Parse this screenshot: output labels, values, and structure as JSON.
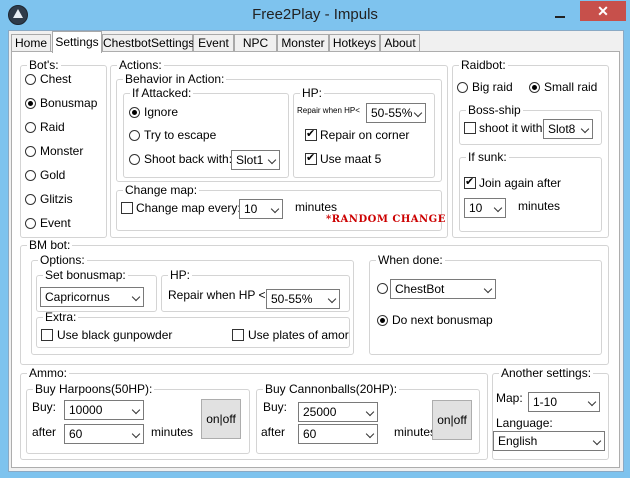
{
  "window": {
    "title": "Free2Play - Impuls",
    "close_glyph": "✕"
  },
  "tabs": [
    "Home",
    "Settings",
    "ChestbotSettings",
    "Event",
    "NPC",
    "Monster",
    "Hotkeys",
    "About"
  ],
  "bots": {
    "title": "Bot's:",
    "options": [
      "Chest",
      "Bonusmap",
      "Raid",
      "Monster",
      "Gold",
      "Glitzis",
      "Event"
    ],
    "selected": "Bonusmap"
  },
  "actions": {
    "title": "Actions:",
    "behavior": {
      "title": "Behavior in Action:",
      "if_attacked": {
        "title": "If Attacked:",
        "ignore": "Ignore",
        "escape": "Try to escape",
        "shoot_back": "Shoot back with:",
        "slot_value": "Slot1"
      },
      "hp": {
        "title": "HP:",
        "repair_label": "Repair when HP<",
        "repair_value": "50-55%",
        "repair_corner": "Repair on corner",
        "use_maat": "Use maat 5"
      }
    },
    "change_map": {
      "title": "Change map:",
      "label": "Change map every:",
      "value": "10",
      "minutes": "minutes",
      "random": "*RANDOM CHANGE"
    }
  },
  "raidbot": {
    "title": "Raidbot:",
    "big": "Big raid",
    "small": "Small raid",
    "boss_ship": {
      "title": "Boss-ship",
      "label": "shoot it with:",
      "value": "Slot8"
    },
    "if_sunk": {
      "title": "If sunk:",
      "join_again": "Join again after",
      "value": "10",
      "minutes": "minutes"
    }
  },
  "bm_bot": {
    "title": "BM bot:",
    "options": {
      "title": "Options:",
      "set_bonusmap": {
        "title": "Set bonusmap:",
        "value": "Capricornus"
      },
      "hp": {
        "title": "HP:",
        "label": "Repair when HP <",
        "value": "50-55%"
      },
      "extra": {
        "title": "Extra:",
        "gunpowder": "Use black gunpowder",
        "plates": "Use plates of amor"
      }
    },
    "when_done": {
      "title": "When done:",
      "chestbot": "ChestBot",
      "next_bonusmap": "Do next bonusmap"
    }
  },
  "ammo": {
    "title": "Ammo:",
    "harpoons": {
      "title": "Buy Harpoons(50HP):",
      "buy_label": "Buy:",
      "buy_value": "10000",
      "after_label": "after",
      "after_value": "60",
      "minutes": "minutes",
      "toggle": "on|off"
    },
    "cannonballs": {
      "title": "Buy Cannonballs(20HP):",
      "buy_label": "Buy:",
      "buy_value": "25000",
      "after_label": "after",
      "after_value": "60",
      "minutes": "minutes",
      "toggle": "on|off"
    }
  },
  "another": {
    "title": "Another settings:",
    "map_label": "Map:",
    "map_value": "1-10",
    "language_label": "Language:",
    "language_value": "English"
  }
}
